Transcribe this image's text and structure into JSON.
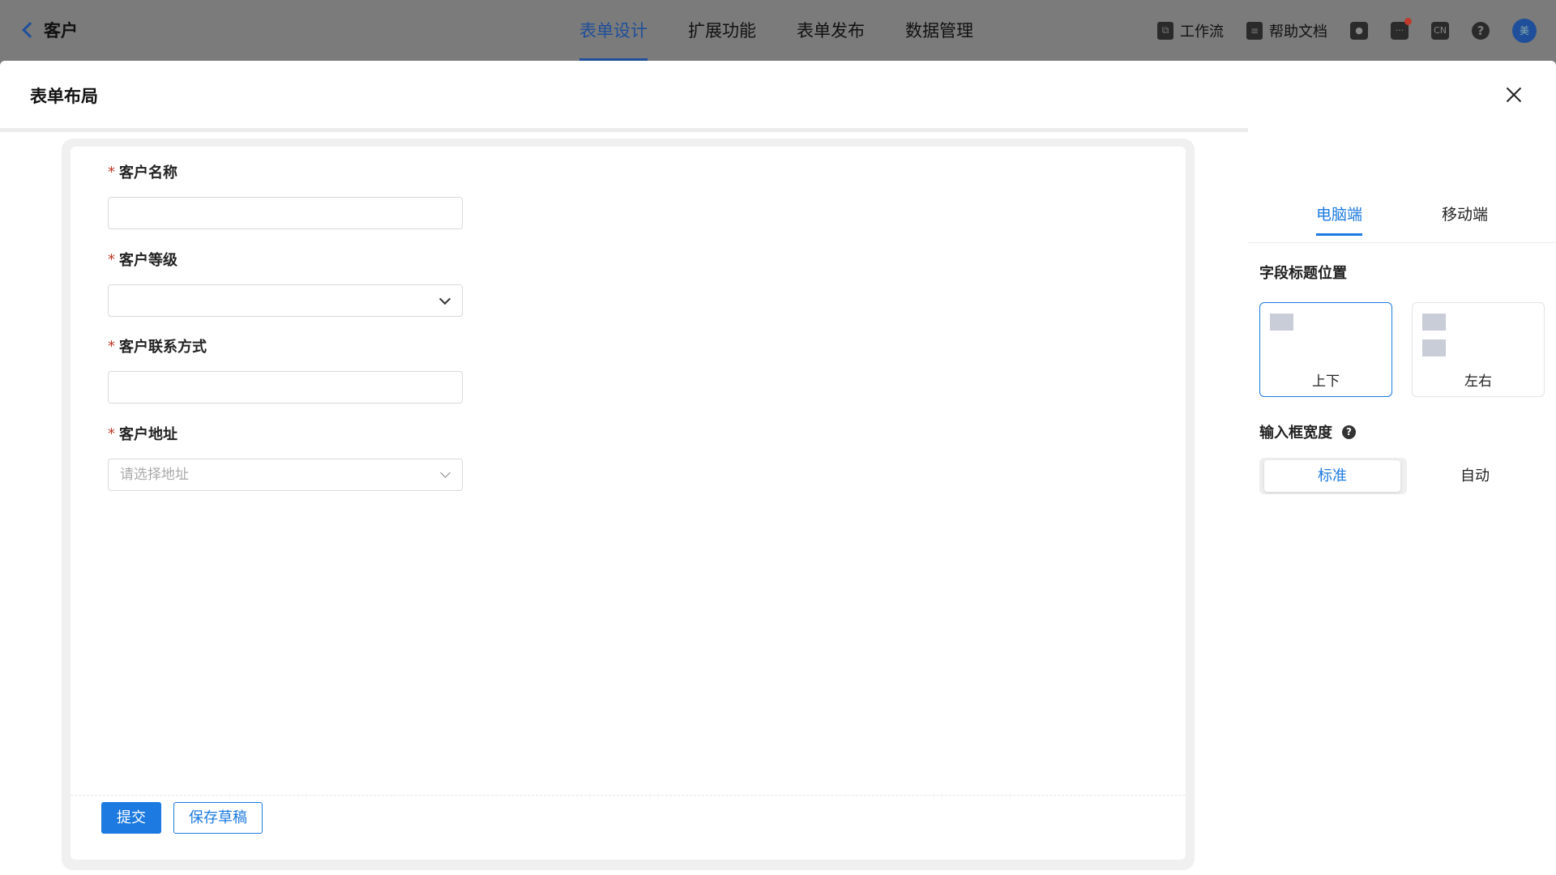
{
  "app": {
    "back_title": "客户",
    "tabs": [
      {
        "label": "表单设计",
        "active": true
      },
      {
        "label": "扩展功能",
        "active": false
      },
      {
        "label": "表单发布",
        "active": false
      },
      {
        "label": "数据管理",
        "active": false
      }
    ],
    "right": {
      "workflow_label": "工作流",
      "help_docs_label": "帮助文档",
      "lang_badge": "CN",
      "help_glyph": "?",
      "avatar_text": "美"
    }
  },
  "modal": {
    "title": "表单布局",
    "fields": [
      {
        "label": "客户名称",
        "required": "*",
        "type": "text",
        "placeholder": ""
      },
      {
        "label": "客户等级",
        "required": "*",
        "type": "select",
        "placeholder": ""
      },
      {
        "label": "客户联系方式",
        "required": "*",
        "type": "text",
        "placeholder": ""
      },
      {
        "label": "客户地址",
        "required": "*",
        "type": "select",
        "placeholder": "请选择地址"
      }
    ],
    "submit_label": "提交",
    "save_draft_label": "保存草稿"
  },
  "settings": {
    "tabs": [
      {
        "label": "电脑端",
        "active": true
      },
      {
        "label": "移动端",
        "active": false
      }
    ],
    "title_position": {
      "heading": "字段标题位置",
      "options": [
        {
          "label": "上下",
          "selected": true
        },
        {
          "label": "左右",
          "selected": false
        }
      ]
    },
    "input_width": {
      "heading": "输入框宽度",
      "help_glyph": "?",
      "options": [
        {
          "label": "标准",
          "selected": true
        },
        {
          "label": "自动",
          "selected": false
        }
      ]
    }
  },
  "colors": {
    "accent": "#1c7ae0",
    "nav_active": "#1f4f9a",
    "required": "#c0392b"
  }
}
